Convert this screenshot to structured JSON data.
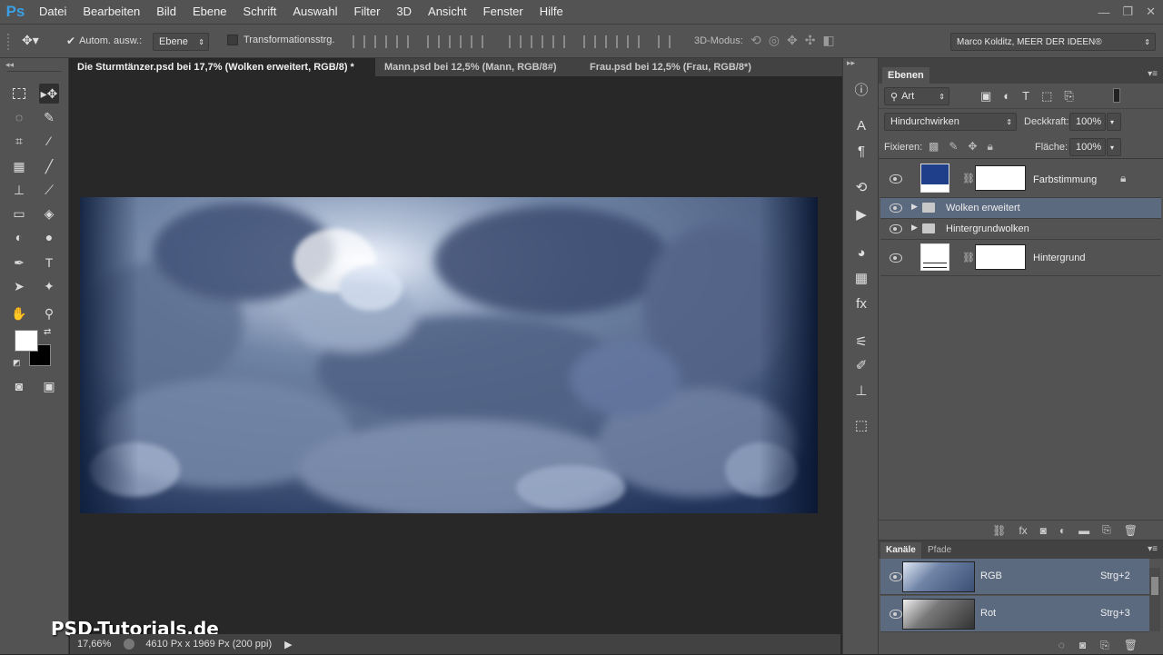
{
  "app": {
    "logo": "Ps"
  },
  "menu": [
    "Datei",
    "Bearbeiten",
    "Bild",
    "Ebene",
    "Schrift",
    "Auswahl",
    "Filter",
    "3D",
    "Ansicht",
    "Fenster",
    "Hilfe"
  ],
  "options": {
    "auto_select_label": "Autom. ausw.:",
    "auto_select_value": "Ebene",
    "transform_label": "Transformationsstrg.",
    "mode3d_label": "3D-Modus:",
    "workspace": "Marco Kolditz, MEER DER IDEEN®"
  },
  "tabs": [
    {
      "label": "Die Sturmtänzer.psd bei 17,7% (Wolken erweitert, RGB/8) *",
      "active": true
    },
    {
      "label": "Mann.psd bei 12,5% (Mann, RGB/8#)",
      "active": false
    },
    {
      "label": "Frau.psd bei 12,5% (Frau, RGB/8*)",
      "active": false
    }
  ],
  "status": {
    "zoom": "17,66%",
    "doc_size": "4610 Px x 1969 Px (200 ppi)"
  },
  "watermark": "PSD-Tutorials.de",
  "layers_panel": {
    "tab": "Ebenen",
    "filter_kind": "Art",
    "blend_mode": "Hindurchwirken",
    "opacity_label": "Deckkraft:",
    "opacity": "100%",
    "lock_label": "Fixieren:",
    "fill_label": "Fläche:",
    "fill": "100%",
    "layers": [
      {
        "name": "Farbstimmung",
        "type": "adjustment",
        "locked": true
      },
      {
        "name": "Wolken erweitert",
        "type": "group",
        "selected": true
      },
      {
        "name": "Hintergrundwolken",
        "type": "group"
      },
      {
        "name": "Hintergrund",
        "type": "adjustment"
      }
    ]
  },
  "channels_panel": {
    "tabs": [
      "Kanäle",
      "Pfade"
    ],
    "channels": [
      {
        "name": "RGB",
        "shortcut": "Strg+2"
      },
      {
        "name": "Rot",
        "shortcut": "Strg+3"
      }
    ]
  },
  "colors": {
    "accent_blue": "#1f3f8a",
    "selected_row": "#5c6a80",
    "ps_blue": "#3aa0e6"
  }
}
